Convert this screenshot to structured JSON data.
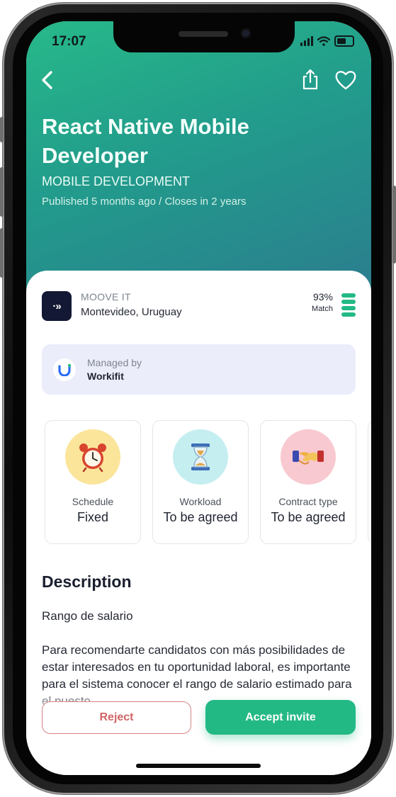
{
  "status_bar": {
    "time": "17:07"
  },
  "header": {
    "back_icon": "chevron-left-icon",
    "share_icon": "share-icon",
    "favorite_icon": "heart-icon"
  },
  "job": {
    "title": "React Native Mobile Developer",
    "category": "MOBILE DEVELOPMENT",
    "published": "Published 5 months ago / Closes in 2 years"
  },
  "company": {
    "logo_text": "·»",
    "name": "MOOVE IT",
    "location": "Montevideo, Uruguay"
  },
  "match": {
    "percent": "93%",
    "label": "Match",
    "level_bars": 4
  },
  "managed": {
    "label": "Managed by",
    "value": "Workifit"
  },
  "tiles": [
    {
      "icon": "alarm-clock-icon",
      "label": "Schedule",
      "value": "Fixed",
      "color": "#fbe59b"
    },
    {
      "icon": "hourglass-icon",
      "label": "Workload",
      "value": "To be agreed",
      "color": "#c5eef1"
    },
    {
      "icon": "handshake-icon",
      "label": "Contract type",
      "value": "To be agreed",
      "color": "#f8c9d0"
    }
  ],
  "description": {
    "heading": "Description",
    "subheading": "Rango de salario",
    "body": "Para recomendarte candidatos con más posibilidades de estar interesados en tu oportunidad laboral, es importante para el sistema conocer el rango de salario estimado para el puesto."
  },
  "actions": {
    "reject": "Reject",
    "accept": "Accept invite"
  },
  "colors": {
    "accent": "#23b985",
    "reject": "#d26466",
    "hero_start": "#27b989",
    "hero_end": "#2c7a8e"
  }
}
